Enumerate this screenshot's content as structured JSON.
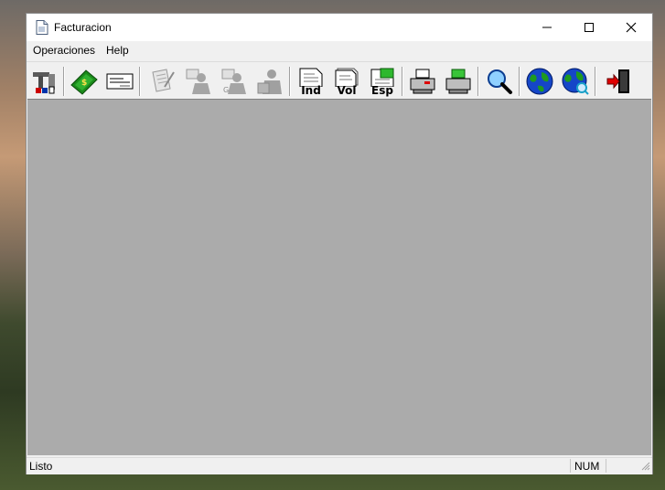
{
  "window": {
    "title": "Facturacion"
  },
  "menu": {
    "items": [
      "Operaciones",
      "Help"
    ]
  },
  "toolbar": {
    "buttons": [
      {
        "icon": "tools-icon",
        "enabled": true
      },
      {
        "icon": "money-icon",
        "enabled": true
      },
      {
        "icon": "check-icon",
        "enabled": true
      },
      {
        "icon": "document-edit-icon",
        "enabled": false
      },
      {
        "icon": "user-document-icon",
        "enabled": false
      },
      {
        "icon": "user-document-g-icon",
        "enabled": false
      },
      {
        "icon": "user-group-icon",
        "enabled": false
      },
      {
        "icon": "page-icon",
        "label": "Ind",
        "enabled": true
      },
      {
        "icon": "page-icon",
        "label": "Vol",
        "enabled": true
      },
      {
        "icon": "page-icon",
        "label": "Esp",
        "enabled": true
      },
      {
        "icon": "printer-icon",
        "enabled": true
      },
      {
        "icon": "printer-green-icon",
        "enabled": true
      },
      {
        "icon": "magnifier-icon",
        "enabled": true
      },
      {
        "icon": "globe-icon",
        "enabled": true
      },
      {
        "icon": "globe-search-icon",
        "enabled": true
      },
      {
        "icon": "exit-door-icon",
        "enabled": true
      }
    ]
  },
  "status": {
    "text": "Listo",
    "num": "NUM"
  },
  "colors": {
    "client_bg": "#ababab",
    "window_bg": "#f0f0f0",
    "title_bg": "#ffffff"
  }
}
